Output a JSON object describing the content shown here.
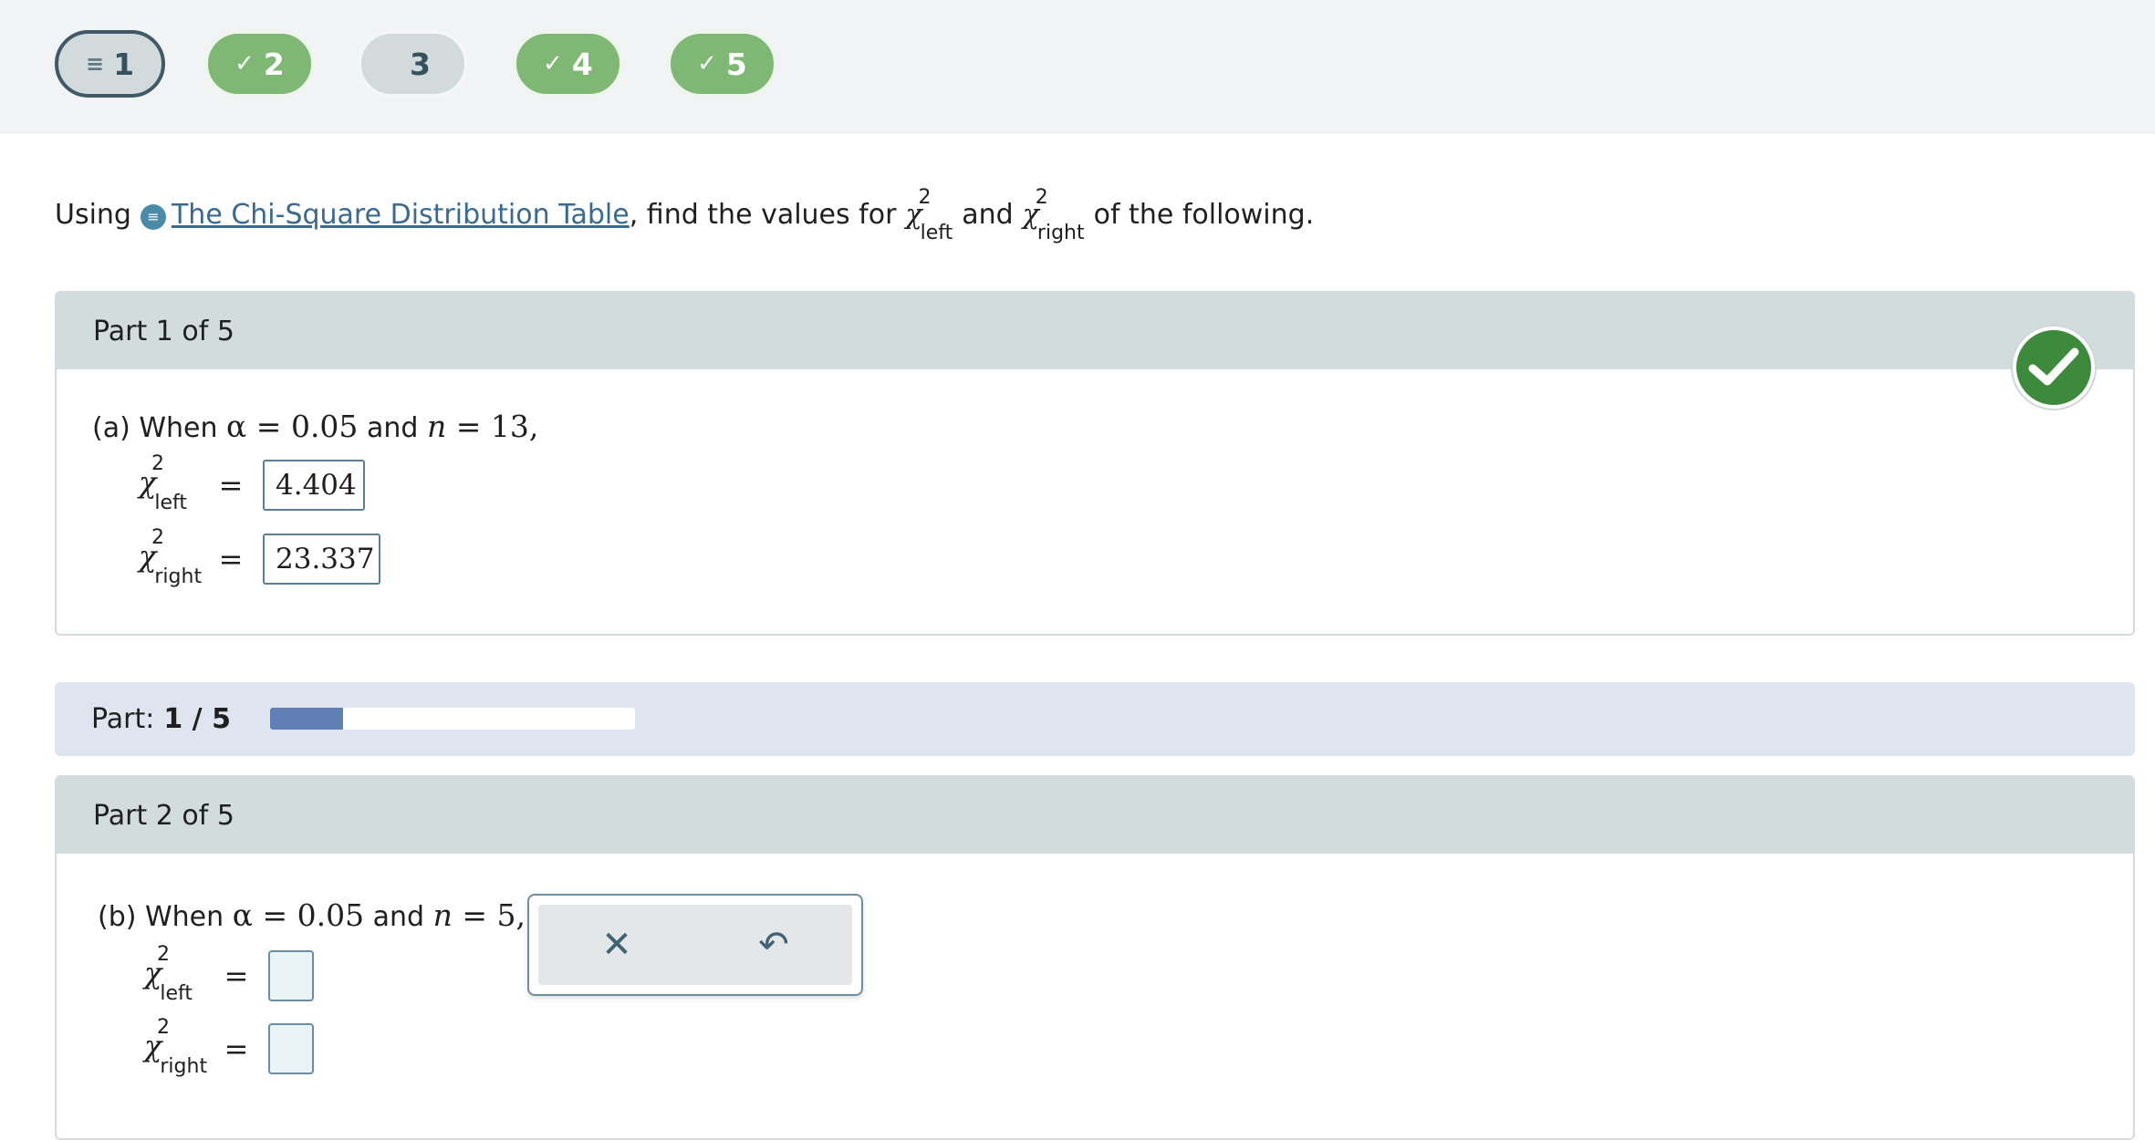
{
  "nav": {
    "questions": [
      {
        "label": "1",
        "state": "current",
        "icon": "list-icon",
        "glyph": "≡"
      },
      {
        "label": "2",
        "state": "done",
        "icon": "check-icon",
        "glyph": "✓"
      },
      {
        "label": "3",
        "state": "pending",
        "icon": "",
        "glyph": ""
      },
      {
        "label": "4",
        "state": "done",
        "icon": "check-icon",
        "glyph": "✓"
      },
      {
        "label": "5",
        "state": "done",
        "icon": "check-icon",
        "glyph": "✓"
      }
    ]
  },
  "prompt": {
    "before": "Using",
    "link": "The Chi-Square Distribution Table",
    "middle": ", find the values for",
    "chi": "χ",
    "sup": "2",
    "left_sub": "left",
    "and": "and",
    "right_sub": "right",
    "after": "of the following."
  },
  "part1": {
    "title": "Part 1 of 5",
    "question_prefix": "(a) When",
    "alpha_expr": "α = 0.05",
    "and": "and",
    "n_var": "n",
    "n_expr": " = 13,",
    "left_answer": "4.404",
    "right_answer": "23.337",
    "status": "correct"
  },
  "progress": {
    "label": "Part:",
    "value": "1 / 5",
    "fraction": 0.2
  },
  "part2": {
    "title": "Part 2 of 5",
    "question_prefix": "(b) When",
    "alpha_expr": "α = 0.05",
    "and": "and",
    "n_var": "n",
    "n_expr": " = 5,",
    "left_answer": "",
    "right_answer": ""
  },
  "actions": {
    "clear_icon": "close-icon",
    "clear_glyph": "✕",
    "undo_icon": "undo-icon",
    "undo_glyph": "↶"
  },
  "symbols": {
    "equals": "="
  }
}
